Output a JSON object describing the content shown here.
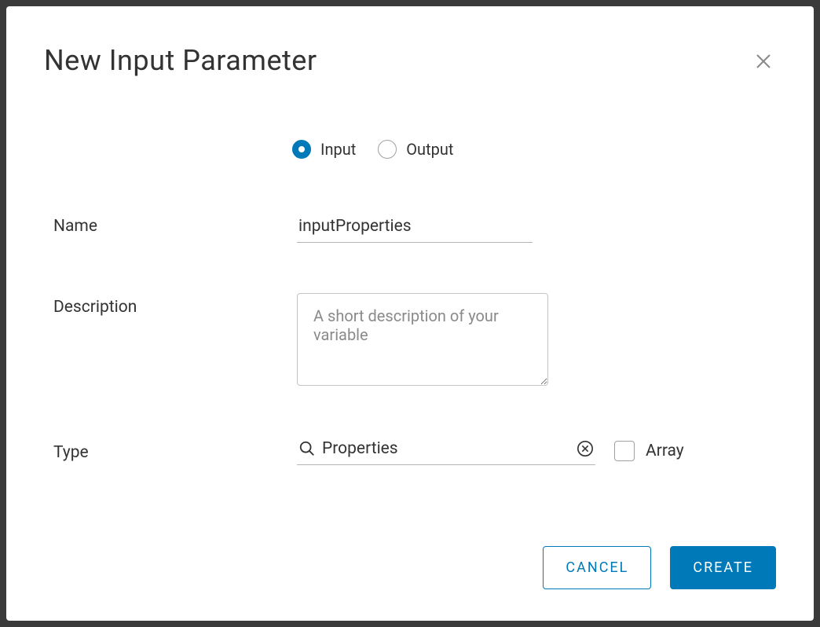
{
  "modal": {
    "title": "New Input Parameter",
    "paramType": {
      "input_label": "Input",
      "output_label": "Output",
      "selected": "input"
    },
    "fields": {
      "name": {
        "label": "Name",
        "value": "inputProperties"
      },
      "description": {
        "label": "Description",
        "placeholder": "A short description of your variable",
        "value": ""
      },
      "type": {
        "label": "Type",
        "value": "Properties",
        "array_label": "Array",
        "array_checked": false
      }
    },
    "buttons": {
      "cancel": "CANCEL",
      "create": "CREATE"
    }
  }
}
